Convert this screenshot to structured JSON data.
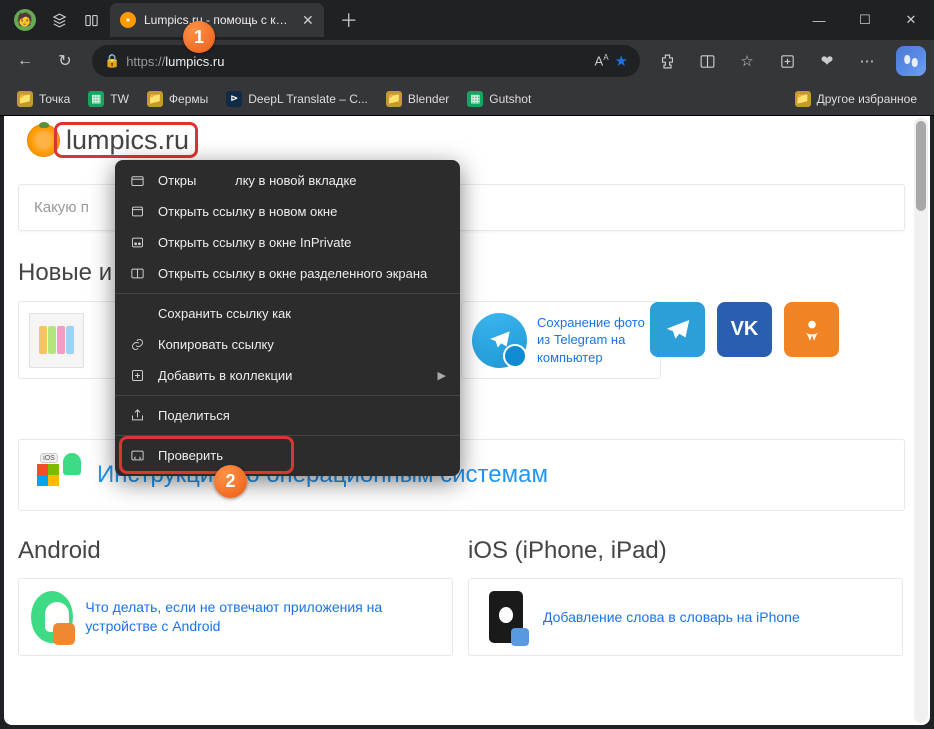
{
  "window": {
    "tab_title": "Lumpics.ru - помощь с компьют",
    "url_prefix": "https://",
    "url_host": "lumpics.ru"
  },
  "bookmarks": {
    "b1": "Точка",
    "b2": "TW",
    "b3": "Фермы",
    "b4": "DeepL Translate – C...",
    "b5": "Blender",
    "b6": "Gutshot",
    "other": "Другое избранное"
  },
  "page": {
    "logo": "lumpics.ru",
    "search_placeholder": "Какую п",
    "heading_new": "Новые и",
    "card_tg": "Сохранение фото из Telegram на компьютер",
    "section_os": "Инструкции по операционным системам",
    "h_android": "Android",
    "h_ios": "iOS (iPhone, iPad)",
    "art_android": "Что делать, если не отвечают приложения на устройстве с Android",
    "art_ios": "Добавление слова в словарь на iPhone"
  },
  "ctx": {
    "open_tab": "Открыть ссылку в новой вкладке",
    "open_tab_short": "Откры",
    "open_tab_rest": "лку в новой вкладке",
    "open_win": "Открыть ссылку в новом окне",
    "open_priv": "Открыть ссылку в окне InPrivate",
    "open_split": "Открыть ссылку в окне разделенного экрана",
    "save_as": "Сохранить ссылку как",
    "copy": "Копировать ссылку",
    "collections": "Добавить в коллекции",
    "share": "Поделиться",
    "inspect": "Проверить"
  },
  "annot": {
    "n1": "1",
    "n2": "2"
  }
}
